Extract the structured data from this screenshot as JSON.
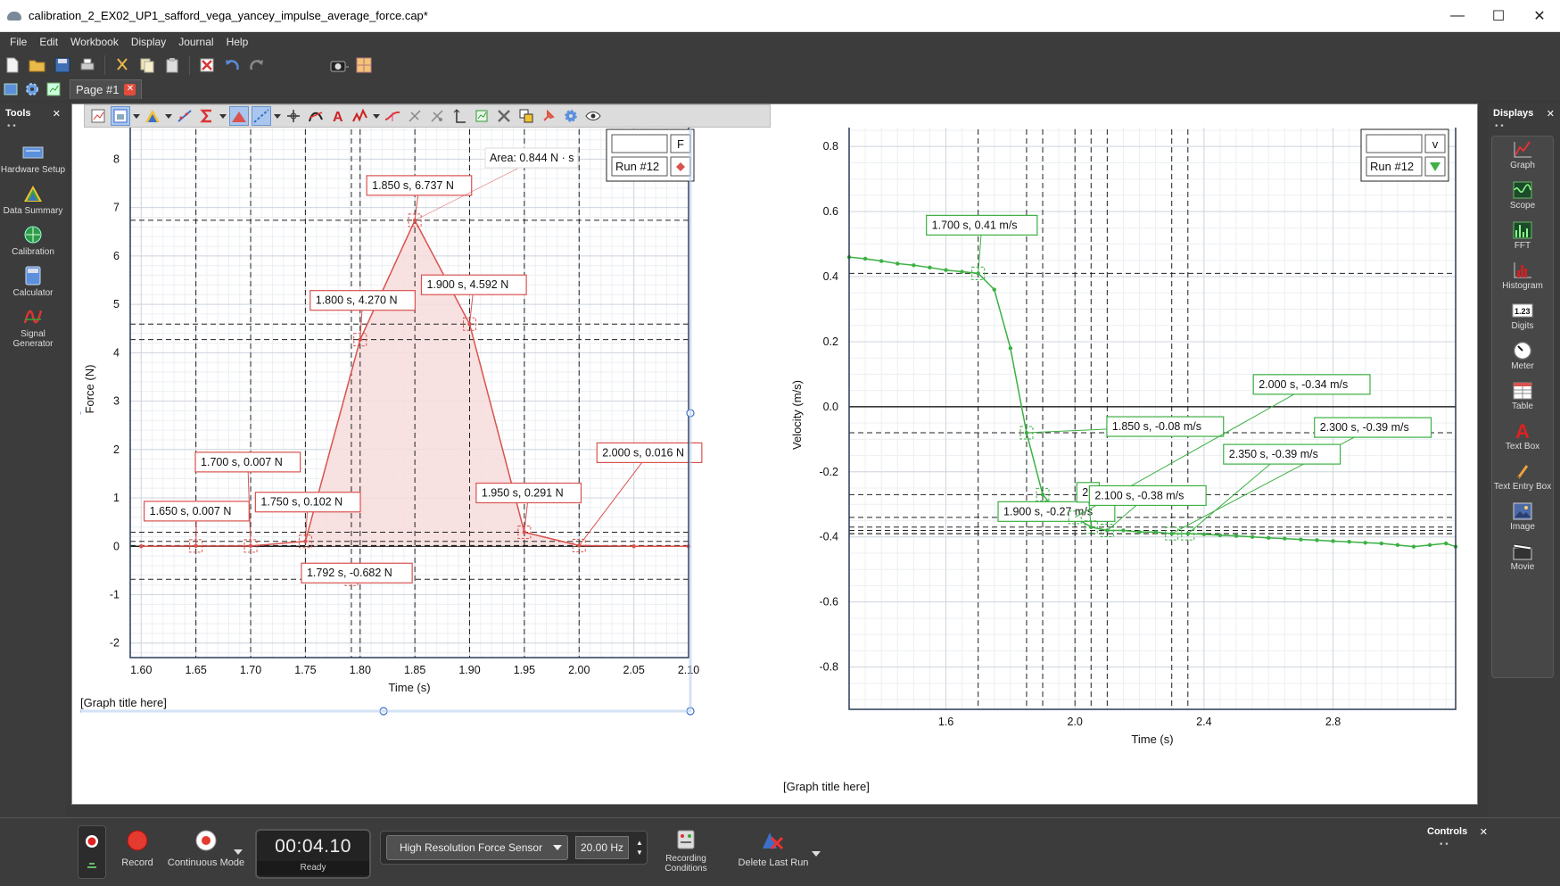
{
  "window": {
    "title": "calibration_2_EX02_UP1_safford_vega_yancey_impulse_average_force.cap*",
    "minimize": "—",
    "maximize": "☐",
    "close": "✕"
  },
  "menu": [
    "File",
    "Edit",
    "Workbook",
    "Display",
    "Journal",
    "Help"
  ],
  "page_tab": {
    "label": "Page #1",
    "close": "✕"
  },
  "tools_panel": {
    "title": "Tools",
    "close": "✕",
    "dots": "• •",
    "items": [
      {
        "label": "Hardware Setup",
        "icon": "hardware-icon"
      },
      {
        "label": "Data Summary",
        "icon": "data-summary-icon"
      },
      {
        "label": "Calibration",
        "icon": "calibration-icon"
      },
      {
        "label": "Calculator",
        "icon": "calculator-icon"
      },
      {
        "label": "Signal Generator",
        "icon": "signal-generator-icon"
      }
    ]
  },
  "displays_panel": {
    "title": "Displays",
    "close": "✕",
    "dots": "• •",
    "items": [
      {
        "label": "Graph",
        "icon": "graph-icon"
      },
      {
        "label": "Scope",
        "icon": "scope-icon"
      },
      {
        "label": "FFT",
        "icon": "fft-icon"
      },
      {
        "label": "Histogram",
        "icon": "histogram-icon"
      },
      {
        "label": "Digits",
        "icon": "digits-icon",
        "glyph": "1.23"
      },
      {
        "label": "Meter",
        "icon": "meter-icon"
      },
      {
        "label": "Table",
        "icon": "table-icon"
      },
      {
        "label": "Text Box",
        "icon": "text-box-icon",
        "glyph": "A"
      },
      {
        "label": "Text Entry Box",
        "icon": "text-entry-icon"
      },
      {
        "label": "Image",
        "icon": "image-icon"
      },
      {
        "label": "Movie",
        "icon": "movie-icon"
      }
    ]
  },
  "controls_panel": {
    "title": "Controls",
    "close": "✕",
    "dots": "• •"
  },
  "controls": {
    "record_label": "Record",
    "mode_label": "Continuous Mode",
    "timer_value": "00:04.10",
    "timer_status": "Ready",
    "sensor": "High Resolution Force Sensor",
    "rate": "20.00 Hz",
    "recording_conditions": "Recording Conditions",
    "delete_last_run": "Delete Last Run"
  },
  "colors": {
    "force_series": "#d9534f",
    "velocity_series": "#3cb043",
    "force_fill": "#f7dcdc"
  },
  "chart_data": [
    {
      "type": "line",
      "title": "[Graph title here]",
      "xlabel": "Time (s)",
      "ylabel": "Force (N)",
      "xlim": [
        1.59,
        2.1
      ],
      "ylim": [
        -2.3,
        8.8
      ],
      "xticks": [
        1.6,
        1.65,
        1.7,
        1.75,
        1.8,
        1.85,
        1.9,
        1.95,
        2.0,
        2.05,
        2.1
      ],
      "xtick_labels": [
        "1.60",
        "1.65",
        "1.70",
        "1.75",
        "1.80",
        "1.85",
        "1.90",
        "1.95",
        "2.00",
        "2.05",
        "2.10"
      ],
      "yticks": [
        -2,
        -1,
        0,
        1,
        2,
        3,
        4,
        5,
        6,
        7,
        8
      ],
      "grid": true,
      "legend_field": "F",
      "legend_run": "Run #12",
      "area_label": "Area: 0.844 N · s",
      "series": [
        {
          "x": [
            1.6,
            1.65,
            1.7,
            1.75,
            1.8,
            1.85,
            1.9,
            1.95,
            2.0,
            2.05,
            2.1
          ],
          "y": [
            0.0,
            0.007,
            0.007,
            0.102,
            4.27,
            6.737,
            4.592,
            0.291,
            0.016,
            0.0,
            0.0
          ]
        }
      ],
      "shaded_range": [
        1.75,
        2.0
      ],
      "annotations": [
        {
          "x": 1.65,
          "y": 0.007,
          "label": "1.650 s, 0.007 N"
        },
        {
          "x": 1.7,
          "y": 0.007,
          "label": "1.700 s, 0.007 N"
        },
        {
          "x": 1.75,
          "y": 0.102,
          "label": "1.750 s, 0.102 N"
        },
        {
          "x": 1.792,
          "y": -0.682,
          "label": "1.792 s, -0.682 N"
        },
        {
          "x": 1.8,
          "y": 4.27,
          "label": "1.800 s, 4.270 N"
        },
        {
          "x": 1.85,
          "y": 6.737,
          "label": "1.850 s, 6.737 N"
        },
        {
          "x": 1.9,
          "y": 4.592,
          "label": "1.900 s, 4.592 N"
        },
        {
          "x": 1.95,
          "y": 0.291,
          "label": "1.950 s, 0.291 N"
        },
        {
          "x": 2.0,
          "y": 0.016,
          "label": "2.000 s, 0.016 N"
        }
      ]
    },
    {
      "type": "line",
      "title": "[Graph title here]",
      "xlabel": "Time (s)",
      "ylabel": "Velocity (m/s)",
      "xlim": [
        1.3,
        3.18
      ],
      "ylim": [
        -0.93,
        0.88
      ],
      "xticks": [
        1.6,
        2.0,
        2.4,
        2.8
      ],
      "xtick_labels": [
        "1.6",
        "2.0",
        "2.4",
        "2.8"
      ],
      "yticks": [
        -0.8,
        -0.6,
        -0.4,
        -0.2,
        0.0,
        0.2,
        0.4,
        0.6,
        0.8
      ],
      "ytick_labels": [
        "-0.8",
        "-0.6",
        "-0.4",
        "-0.2",
        "0.0",
        "0.2",
        "0.4",
        "0.6",
        "0.8"
      ],
      "grid": true,
      "legend_field": "v",
      "legend_run": "Run #12",
      "series": [
        {
          "x": [
            1.3,
            1.35,
            1.4,
            1.45,
            1.5,
            1.55,
            1.6,
            1.65,
            1.7,
            1.75,
            1.8,
            1.85,
            1.9,
            1.95,
            2.0,
            2.05,
            2.1,
            2.15,
            2.2,
            2.25,
            2.3,
            2.35,
            2.4,
            2.45,
            2.5,
            2.55,
            2.6,
            2.65,
            2.7,
            2.75,
            2.8,
            2.85,
            2.9,
            2.95,
            3.0,
            3.05,
            3.1,
            3.15,
            3.18
          ],
          "y": [
            0.46,
            0.455,
            0.448,
            0.44,
            0.435,
            0.428,
            0.42,
            0.415,
            0.41,
            0.36,
            0.18,
            -0.08,
            -0.27,
            -0.33,
            -0.34,
            -0.37,
            -0.38,
            -0.38,
            -0.385,
            -0.385,
            -0.39,
            -0.39,
            -0.392,
            -0.395,
            -0.397,
            -0.4,
            -0.403,
            -0.405,
            -0.408,
            -0.41,
            -0.413,
            -0.415,
            -0.418,
            -0.42,
            -0.425,
            -0.43,
            -0.425,
            -0.42,
            -0.43
          ]
        }
      ],
      "annotations": [
        {
          "x": 1.7,
          "y": 0.41,
          "label": "1.700 s, 0.41 m/s"
        },
        {
          "x": 1.85,
          "y": -0.08,
          "label": "1.850 s, -0.08 m/s"
        },
        {
          "x": 1.9,
          "y": -0.27,
          "label": "1.900 s, -0.27 m/s"
        },
        {
          "x": 2.0,
          "y": -0.34,
          "label": "2.000 s, -0.34 m/s"
        },
        {
          "x": 2.05,
          "y": -0.37,
          "label": "2."
        },
        {
          "x": 2.1,
          "y": -0.38,
          "label": "2.100 s, -0.38 m/s"
        },
        {
          "x": 2.3,
          "y": -0.39,
          "label": "2.300 s, -0.39 m/s"
        },
        {
          "x": 2.35,
          "y": -0.39,
          "label": "2.350 s, -0.39 m/s"
        }
      ]
    }
  ]
}
